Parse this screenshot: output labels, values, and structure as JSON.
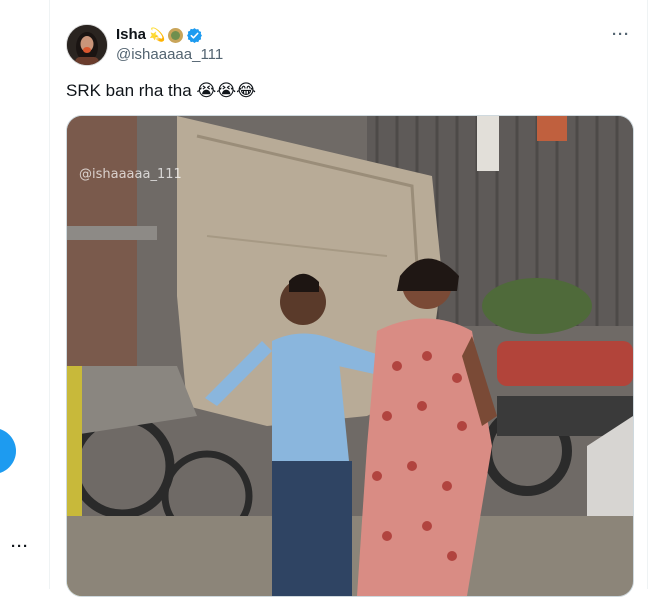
{
  "tweet": {
    "author_name": "Isha",
    "name_emoji": "💫",
    "handle": "@ishaaaaa_111",
    "more_label": "···",
    "text": "SRK ban rha tha 😭😭😂",
    "media_watermark": "@ishaaaaa_111"
  },
  "sidebar": {
    "more_label": "···"
  },
  "colors": {
    "accent": "#1d9bf0",
    "secondary_text": "#536471"
  },
  "icons": {
    "verified": "verified-badge-icon",
    "affiliate": "affiliate-badge-icon",
    "more": "more-horizontal-icon"
  }
}
